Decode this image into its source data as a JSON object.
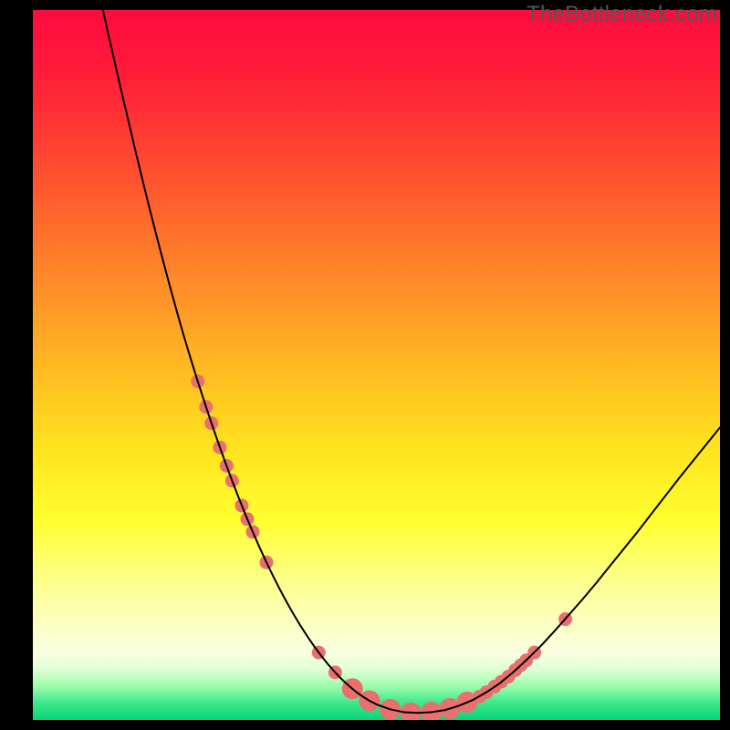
{
  "watermark": "TheBottleneck.com",
  "chart_data": {
    "type": "line",
    "title": "",
    "xlabel": "",
    "ylabel": "",
    "xlim": [
      0,
      100
    ],
    "ylim": [
      0,
      100
    ],
    "background_gradient": {
      "stops": [
        {
          "offset": 0.0,
          "color": "#ff0a3f"
        },
        {
          "offset": 0.08,
          "color": "#ff1a3a"
        },
        {
          "offset": 0.2,
          "color": "#ff4431"
        },
        {
          "offset": 0.35,
          "color": "#ff7e2a"
        },
        {
          "offset": 0.5,
          "color": "#ffb822"
        },
        {
          "offset": 0.62,
          "color": "#ffe41e"
        },
        {
          "offset": 0.72,
          "color": "#ffff30"
        },
        {
          "offset": 0.8,
          "color": "#fdff86"
        },
        {
          "offset": 0.86,
          "color": "#fbffbe"
        },
        {
          "offset": 0.905,
          "color": "#f8ffe0"
        },
        {
          "offset": 0.925,
          "color": "#e5ffda"
        },
        {
          "offset": 0.94,
          "color": "#c3ffc0"
        },
        {
          "offset": 0.955,
          "color": "#93fbaa"
        },
        {
          "offset": 0.975,
          "color": "#41e88d"
        },
        {
          "offset": 1.0,
          "color": "#08d477"
        }
      ]
    },
    "series": [
      {
        "name": "bottleneck-curve",
        "color": "#000000",
        "stroke_width": 2.0,
        "x": [
          10.2,
          11,
          12,
          13,
          14,
          15,
          16,
          17,
          18,
          19,
          20,
          21,
          22,
          23,
          24,
          25,
          26,
          27,
          28,
          29,
          30,
          31,
          32,
          33,
          34,
          35,
          36,
          37,
          38,
          39,
          40,
          41,
          42,
          43,
          44,
          45,
          46,
          47,
          48,
          49,
          50,
          52,
          54,
          56,
          58,
          60,
          62,
          64,
          66,
          68,
          70,
          72,
          74,
          76,
          78,
          80,
          82,
          84,
          86,
          88,
          90,
          92,
          94,
          96,
          98,
          100
        ],
        "y": [
          100,
          96.5,
          92.3,
          88.1,
          84,
          79.9,
          75.9,
          72,
          68.2,
          64.5,
          60.9,
          57.4,
          54,
          50.8,
          47.7,
          44.7,
          41.8,
          39,
          36.3,
          33.7,
          31.2,
          28.8,
          26.5,
          24.3,
          22.2,
          20.2,
          18.3,
          16.5,
          14.8,
          13.2,
          11.7,
          10.3,
          9,
          7.8,
          6.7,
          5.7,
          4.8,
          4,
          3.3,
          2.7,
          2.2,
          1.5,
          1.1,
          1.0,
          1.1,
          1.4,
          2.0,
          2.8,
          3.9,
          5.2,
          6.8,
          8.6,
          10.5,
          12.6,
          14.8,
          17.0,
          19.3,
          21.7,
          24.1,
          26.5,
          29.0,
          31.5,
          34.0,
          36.4,
          38.8,
          41.2
        ]
      }
    ],
    "markers": {
      "name": "highlighted-points",
      "color": "#e9706e",
      "radius_small": 7.5,
      "radius_large": 11.5,
      "points": [
        {
          "x": 24.0,
          "y": 47.7,
          "r": "small"
        },
        {
          "x": 25.2,
          "y": 44.1,
          "r": "small"
        },
        {
          "x": 26.0,
          "y": 41.8,
          "r": "small"
        },
        {
          "x": 27.2,
          "y": 38.4,
          "r": "small"
        },
        {
          "x": 28.2,
          "y": 35.8,
          "r": "small"
        },
        {
          "x": 29.0,
          "y": 33.7,
          "r": "small"
        },
        {
          "x": 30.4,
          "y": 30.2,
          "r": "small"
        },
        {
          "x": 31.2,
          "y": 28.3,
          "r": "small"
        },
        {
          "x": 32.0,
          "y": 26.5,
          "r": "small"
        },
        {
          "x": 34.0,
          "y": 22.2,
          "r": "small"
        },
        {
          "x": 41.6,
          "y": 9.5,
          "r": "small"
        },
        {
          "x": 44.0,
          "y": 6.7,
          "r": "small"
        },
        {
          "x": 46.5,
          "y": 4.4,
          "r": "large"
        },
        {
          "x": 49.0,
          "y": 2.7,
          "r": "large"
        },
        {
          "x": 52.0,
          "y": 1.5,
          "r": "large"
        },
        {
          "x": 55.0,
          "y": 1.0,
          "r": "large"
        },
        {
          "x": 58.0,
          "y": 1.1,
          "r": "large"
        },
        {
          "x": 60.7,
          "y": 1.6,
          "r": "large"
        },
        {
          "x": 63.2,
          "y": 2.5,
          "r": "large"
        },
        {
          "x": 65.0,
          "y": 3.3,
          "r": "small"
        },
        {
          "x": 66.0,
          "y": 3.9,
          "r": "small"
        },
        {
          "x": 67.2,
          "y": 4.7,
          "r": "small"
        },
        {
          "x": 68.2,
          "y": 5.4,
          "r": "small"
        },
        {
          "x": 69.2,
          "y": 6.1,
          "r": "small"
        },
        {
          "x": 70.2,
          "y": 7.0,
          "r": "small"
        },
        {
          "x": 71.0,
          "y": 7.7,
          "r": "small"
        },
        {
          "x": 71.8,
          "y": 8.4,
          "r": "small"
        },
        {
          "x": 73.0,
          "y": 9.5,
          "r": "small"
        },
        {
          "x": 77.5,
          "y": 14.2,
          "r": "small"
        }
      ]
    }
  }
}
